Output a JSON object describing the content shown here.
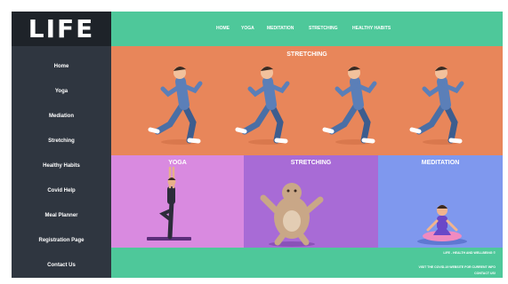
{
  "logo": "LIFE",
  "sidebar": {
    "items": [
      {
        "label": "Home"
      },
      {
        "label": "Yoga"
      },
      {
        "label": "Mediation"
      },
      {
        "label": "Stretching"
      },
      {
        "label": "Healthy Habits"
      },
      {
        "label": "Covid Help"
      },
      {
        "label": "Meal Planner"
      },
      {
        "label": "Registration Page"
      },
      {
        "label": "Contact Us"
      }
    ]
  },
  "topnav": {
    "items": [
      {
        "label": "HOME"
      },
      {
        "label": "YOGA"
      },
      {
        "label": "MEDITATION"
      },
      {
        "label": "STRETCHING"
      },
      {
        "label": "HEALTHY HABITS"
      }
    ]
  },
  "hero": {
    "title": "STRETCHING",
    "text": "",
    "background": "#e8865a"
  },
  "cards": [
    {
      "title": "YOGA",
      "text": "",
      "color": "#d98ae0"
    },
    {
      "title": "STRETCHING",
      "text": "",
      "color": "#a86bd6"
    },
    {
      "title": "MEDITATION",
      "text": "",
      "color": "#7f98ee"
    }
  ],
  "footer": {
    "line1": "LIFE - HEALTH AND WELLBEING ©",
    "line2": "VISIT THE COVID-19 WEBSITE FOR CURRENT INFO",
    "line3": "CONTACT US!"
  },
  "colors": {
    "accent": "#4ec89a",
    "sidebar": "#2f3640",
    "logo_bg": "#1e2329"
  }
}
